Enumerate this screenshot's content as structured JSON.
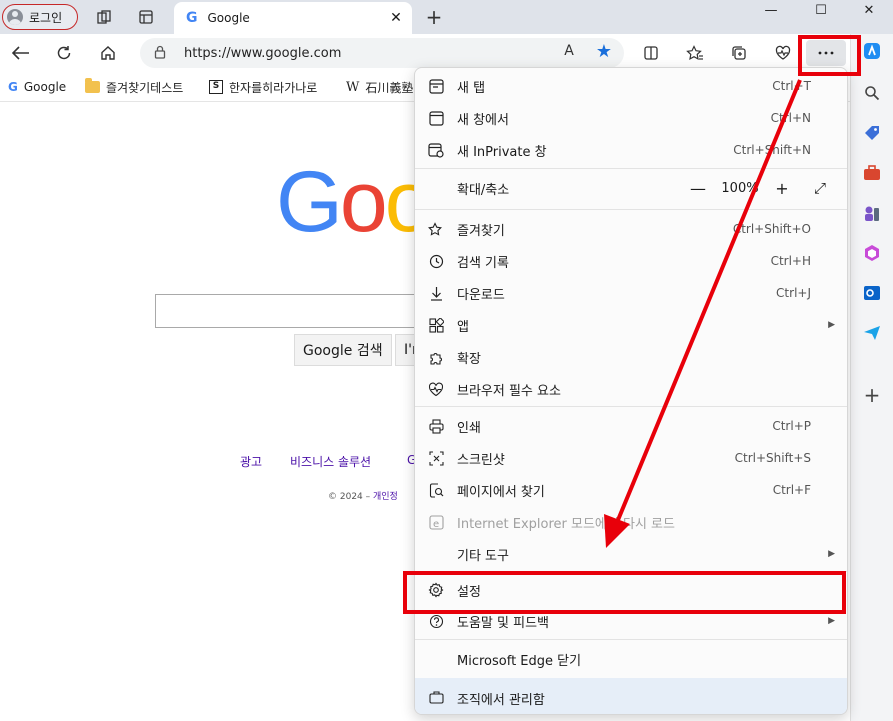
{
  "titlebar": {
    "profile_label": "로그인",
    "tab_title": "Google",
    "tab_favicon": "G",
    "new_tab_glyph": "+",
    "minimize_glyph": "—",
    "maximize_glyph": "☐",
    "close_glyph": "✕"
  },
  "address": {
    "url": "https://www.google.com",
    "read_aloud_glyph": "A",
    "favorite_glyph": "★"
  },
  "bookmarks": [
    {
      "label": "Google"
    },
    {
      "label": "즐겨찾기테스트"
    },
    {
      "label": "한자를히라가나로"
    },
    {
      "label": "石川義塾"
    }
  ],
  "google": {
    "logo_part1": "G",
    "logo_part2": "o",
    "logo_part3": "o",
    "search_button": "Google 검색",
    "lucky_button": "I'm",
    "footer_ad": "광고",
    "footer_business": "비즈니스 솔루션",
    "footer_about": "G",
    "copyright": "© 2024 – ",
    "privacy": "개인정"
  },
  "menu": {
    "new_tab": {
      "label": "새 탭",
      "shortcut": "Ctrl+T"
    },
    "new_window": {
      "label": "새 창에서",
      "shortcut": "Ctrl+N"
    },
    "new_inprivate": {
      "label": "새 InPrivate 창",
      "shortcut": "Ctrl+Shift+N"
    },
    "zoom": {
      "label": "확대/축소",
      "minus": "—",
      "value": "100%",
      "plus": "+",
      "fullscreen": "⤢"
    },
    "favorites": {
      "label": "즐겨찾기",
      "shortcut": "Ctrl+Shift+O"
    },
    "history": {
      "label": "검색 기록",
      "shortcut": "Ctrl+H"
    },
    "downloads": {
      "label": "다운로드",
      "shortcut": "Ctrl+J"
    },
    "apps": {
      "label": "앱"
    },
    "extensions": {
      "label": "확장"
    },
    "essentials": {
      "label": "브라우저 필수 요소"
    },
    "print": {
      "label": "인쇄",
      "shortcut": "Ctrl+P"
    },
    "screenshot": {
      "label": "스크린샷",
      "shortcut": "Ctrl+Shift+S"
    },
    "find": {
      "label": "페이지에서 찾기",
      "shortcut": "Ctrl+F"
    },
    "ie_mode": {
      "label": "Internet Explorer 모드에서 다시 로드"
    },
    "more_tools": {
      "label": "기타 도구"
    },
    "settings": {
      "label": "설정"
    },
    "help": {
      "label": "도움말 및 피드백"
    },
    "close_edge": {
      "label": "Microsoft Edge 닫기"
    },
    "managed": {
      "label": "조직에서 관리함"
    }
  },
  "colors": {
    "annotation_red": "#e8000a",
    "accent_blue": "#1a6fdb"
  }
}
